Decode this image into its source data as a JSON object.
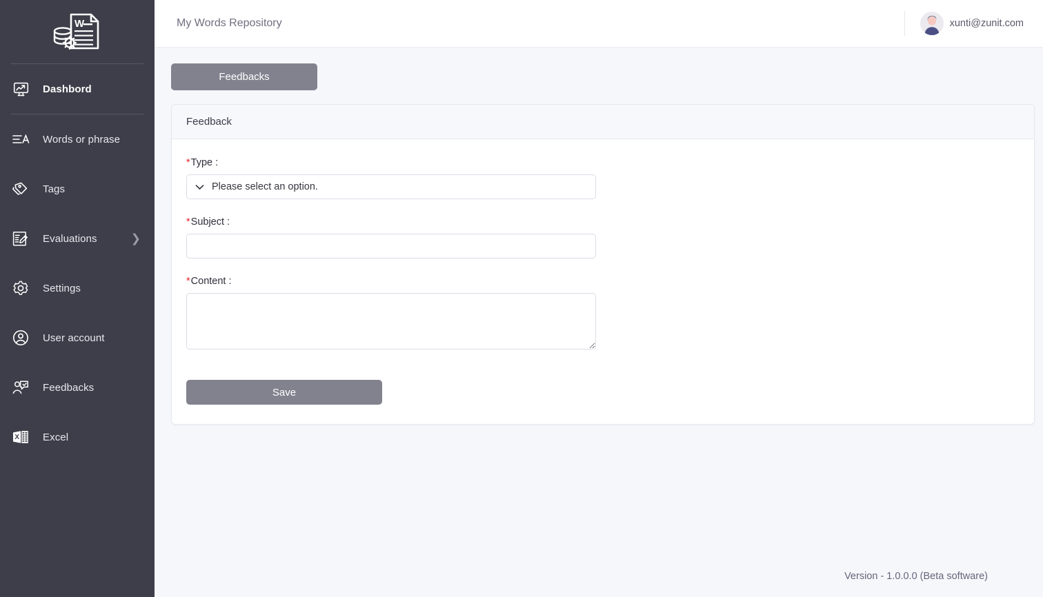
{
  "sidebar": {
    "logo_icon": "word-document-database-logo",
    "items": [
      {
        "label": "Dashbord",
        "icon": "monitor-chart-icon",
        "active": true,
        "has_submenu": false
      },
      {
        "label": "Words or phrase",
        "icon": "text-lines-a-icon",
        "active": false,
        "has_submenu": false
      },
      {
        "label": "Tags",
        "icon": "tags-icon",
        "active": false,
        "has_submenu": false
      },
      {
        "label": "Evaluations",
        "icon": "clipboard-exam-icon",
        "active": false,
        "has_submenu": true
      },
      {
        "label": "Settings",
        "icon": "gear-icon",
        "active": false,
        "has_submenu": false
      },
      {
        "label": "User account",
        "icon": "user-circle-icon",
        "active": false,
        "has_submenu": false
      },
      {
        "label": "Feedbacks",
        "icon": "user-speech-icon",
        "active": false,
        "has_submenu": false
      },
      {
        "label": "Excel",
        "icon": "excel-icon",
        "active": false,
        "has_submenu": false
      }
    ],
    "submenu_icon": "chevron-right-icon"
  },
  "topbar": {
    "title": "My Words Repository",
    "user_email": "xunti@zunit.com",
    "avatar_icon": "user-avatar"
  },
  "tabs": [
    {
      "label": "Feedbacks",
      "active": true
    }
  ],
  "card": {
    "header": "Feedback",
    "fields": {
      "type": {
        "label": "Type :",
        "required_mark": "*",
        "selected_option": "Please select an option.",
        "dropdown_icon": "chevron-down-icon"
      },
      "subject": {
        "label": "Subject :",
        "required_mark": "*",
        "value": "",
        "placeholder": ""
      },
      "content": {
        "label": "Content :",
        "required_mark": "*",
        "value": "",
        "placeholder": ""
      }
    },
    "save_label": "Save"
  },
  "footer": {
    "version": "Version - 1.0.0.0 (Beta software)"
  },
  "colors": {
    "sidebar_bg": "#3e3e4a",
    "page_bg": "#f6f7fb",
    "card_header_bg": "#f7f8fc",
    "button_bg": "#82828f",
    "required_red": "#e8242a"
  }
}
